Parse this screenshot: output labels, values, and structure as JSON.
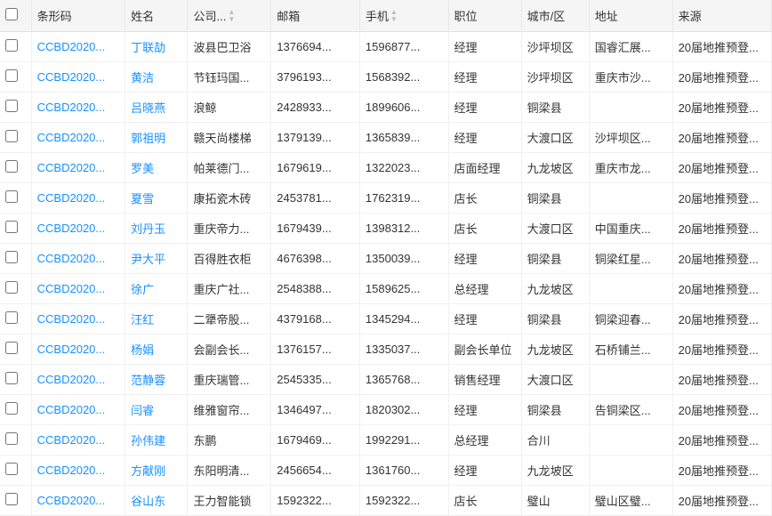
{
  "colors": {
    "link": "#1890ff",
    "header_bg": "#f5f5f5",
    "border": "#e0e0e0"
  },
  "table": {
    "columns": [
      {
        "key": "checkbox",
        "label": ""
      },
      {
        "key": "barcode",
        "label": "条形码"
      },
      {
        "key": "name",
        "label": "姓名"
      },
      {
        "key": "company",
        "label": "公司...",
        "sortable": true
      },
      {
        "key": "email",
        "label": "邮箱"
      },
      {
        "key": "phone",
        "label": "手机",
        "sortable": true
      },
      {
        "key": "position",
        "label": "职位"
      },
      {
        "key": "city",
        "label": "城市/区"
      },
      {
        "key": "address",
        "label": "地址"
      },
      {
        "key": "source",
        "label": "来源"
      }
    ],
    "rows": [
      {
        "barcode": "CCBD2020...",
        "name": "丁联劼",
        "company": "波县巴卫浴",
        "email": "1376694...",
        "phone": "1596877...",
        "position": "经理",
        "city": "沙坪坝区",
        "address": "国睿汇展...",
        "source": "20届地推预登..."
      },
      {
        "barcode": "CCBD2020...",
        "name": "黄洁",
        "company": "节钰玛国...",
        "email": "3796193...",
        "phone": "1568392...",
        "position": "经理",
        "city": "沙坪坝区",
        "address": "重庆市沙...",
        "source": "20届地推预登..."
      },
      {
        "barcode": "CCBD2020...",
        "name": "吕晓燕",
        "company": "浪鲸",
        "email": "2428933...",
        "phone": "1899606...",
        "position": "经理",
        "city": "铜梁县",
        "address": "",
        "source": "20届地推预登..."
      },
      {
        "barcode": "CCBD2020...",
        "name": "郭祖明",
        "company": "赣天尚楼梯",
        "email": "1379139...",
        "phone": "1365839...",
        "position": "经理",
        "city": "大渡口区",
        "address": "沙坪坝区...",
        "source": "20届地推预登..."
      },
      {
        "barcode": "CCBD2020...",
        "name": "罗美",
        "company": "帕莱德门...",
        "email": "1679619...",
        "phone": "1322023...",
        "position": "店面经理",
        "city": "九龙坡区",
        "address": "重庆市龙...",
        "source": "20届地推预登..."
      },
      {
        "barcode": "CCBD2020...",
        "name": "夏雪",
        "company": "康拓瓷木砖",
        "email": "2453781...",
        "phone": "1762319...",
        "position": "店长",
        "city": "铜梁县",
        "address": "",
        "source": "20届地推预登..."
      },
      {
        "barcode": "CCBD2020...",
        "name": "刘丹玉",
        "company": "重庆帝力...",
        "email": "1679439...",
        "phone": "1398312...",
        "position": "店长",
        "city": "大渡口区",
        "address": "中国重庆...",
        "source": "20届地推预登..."
      },
      {
        "barcode": "CCBD2020...",
        "name": "尹大平",
        "company": "百得胜衣柜",
        "email": "4676398...",
        "phone": "1350039...",
        "position": "经理",
        "city": "铜梁县",
        "address": "铜梁红星...",
        "source": "20届地推预登..."
      },
      {
        "barcode": "CCBD2020...",
        "name": "徐广",
        "company": "重庆广社...",
        "email": "2548388...",
        "phone": "1589625...",
        "position": "总经理",
        "city": "九龙坡区",
        "address": "",
        "source": "20届地推预登..."
      },
      {
        "barcode": "CCBD2020...",
        "name": "汪红",
        "company": "二犟帝股...",
        "email": "4379168...",
        "phone": "1345294...",
        "position": "经理",
        "city": "铜梁县",
        "address": "铜梁迎春...",
        "source": "20届地推预登..."
      },
      {
        "barcode": "CCBD2020...",
        "name": "杨娟",
        "company": "会副会长...",
        "email": "1376157...",
        "phone": "1335037...",
        "position": "副会长单位",
        "city": "九龙坡区",
        "address": "石桥铺兰...",
        "source": "20届地推预登..."
      },
      {
        "barcode": "CCBD2020...",
        "name": "范静蓉",
        "company": "重庆瑞管...",
        "email": "2545335...",
        "phone": "1365768...",
        "position": "销售经理",
        "city": "大渡口区",
        "address": "",
        "source": "20届地推预登..."
      },
      {
        "barcode": "CCBD2020...",
        "name": "闫睿",
        "company": "维雅窗帘...",
        "email": "1346497...",
        "phone": "1820302...",
        "position": "经理",
        "city": "铜梁县",
        "address": "告铜梁区...",
        "source": "20届地推预登..."
      },
      {
        "barcode": "CCBD2020...",
        "name": "孙伟建",
        "company": "东鹏",
        "email": "1679469...",
        "phone": "1992291...",
        "position": "总经理",
        "city": "合川",
        "address": "",
        "source": "20届地推预登..."
      },
      {
        "barcode": "CCBD2020...",
        "name": "方献刚",
        "company": "东阳明清...",
        "email": "2456654...",
        "phone": "1361760...",
        "position": "经理",
        "city": "九龙坡区",
        "address": "",
        "source": "20届地推预登..."
      },
      {
        "barcode": "CCBD2020...",
        "name": "谷山东",
        "company": "王力智能锁",
        "email": "1592322...",
        "phone": "1592322...",
        "position": "店长",
        "city": "璧山",
        "address": "璧山区璧...",
        "source": "20届地推预登..."
      }
    ]
  }
}
